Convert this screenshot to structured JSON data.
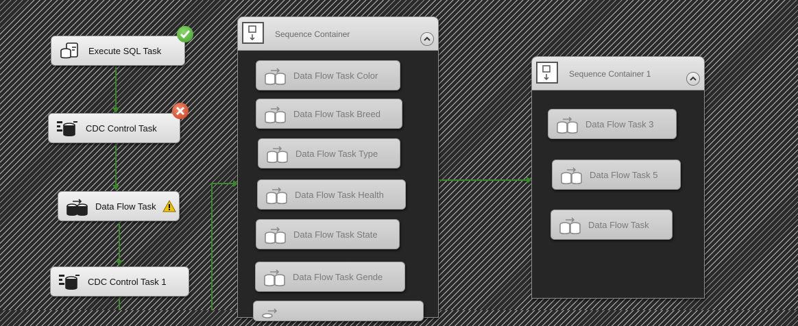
{
  "main_tasks": [
    {
      "name": "execute-sql-task",
      "label": "Execute SQL Task",
      "status": "success"
    },
    {
      "name": "cdc-control-task",
      "label": "CDC Control Task",
      "status": "failure"
    },
    {
      "name": "data-flow-task",
      "label": "Data Flow Task",
      "status": "warning"
    },
    {
      "name": "cdc-control-task-1",
      "label": "CDC Control Task 1",
      "status": ""
    }
  ],
  "sequence_container": {
    "title": "Sequence Container",
    "tasks": [
      "Data Flow Task Color",
      "Data Flow Task Breed",
      "Data Flow Task Type",
      "Data Flow Task Health",
      "Data Flow Task State",
      "Data Flow Task Gende"
    ]
  },
  "sequence_container_1": {
    "title": "Sequence Container 1",
    "tasks": [
      "Data Flow Task 3",
      "Data Flow Task 5",
      "Data Flow Task"
    ]
  },
  "colors": {
    "precedence_line": "#3a8a2a",
    "success": "#5cb83a",
    "failure": "#d9442a",
    "warning": "#f0c400"
  },
  "icons": {
    "execute_sql": "execute-sql-icon",
    "cdc": "cdc-control-icon",
    "data_flow": "data-flow-icon",
    "container": "sequence-container-icon"
  }
}
